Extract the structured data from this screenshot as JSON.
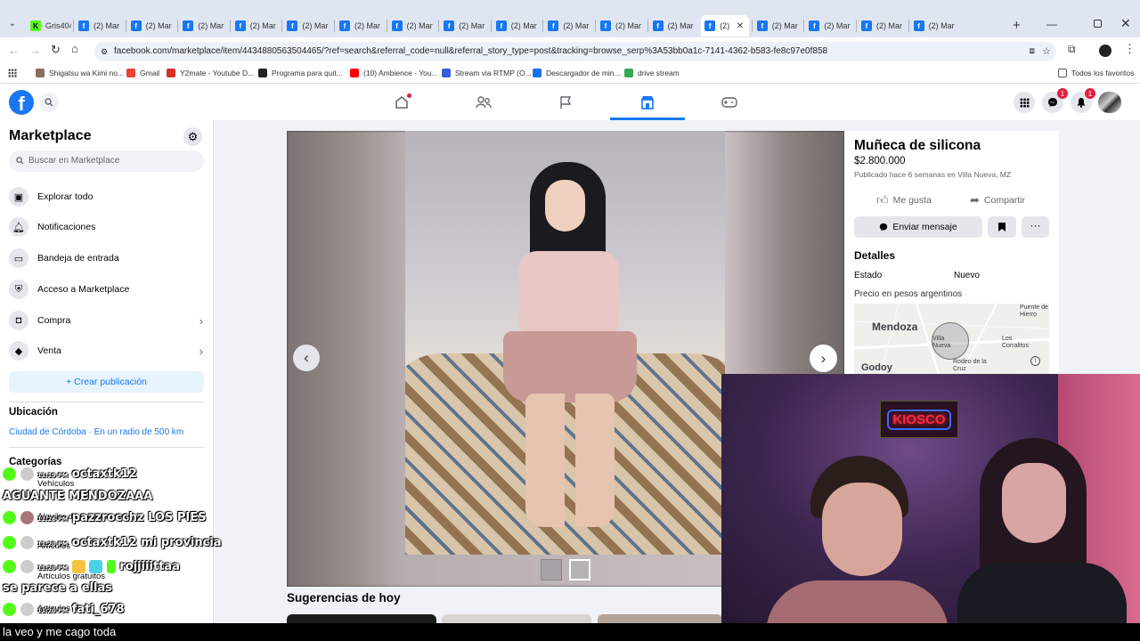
{
  "browser": {
    "tabs": [
      {
        "label": "Gris404",
        "icon": "kick-icon"
      },
      {
        "label": "(2) Mar"
      },
      {
        "label": "(2) Mar"
      },
      {
        "label": "(2) Mar"
      },
      {
        "label": "(2) Mar"
      },
      {
        "label": "(2) Mar"
      },
      {
        "label": "(2) Mar"
      },
      {
        "label": "(2) Mar"
      },
      {
        "label": "(2) Mar"
      },
      {
        "label": "(2) Mar"
      },
      {
        "label": "(2) Mar"
      },
      {
        "label": "(2) Mar"
      },
      {
        "label": "(2) Mar"
      },
      {
        "label": "(2)",
        "active": true
      },
      {
        "label": "(2) Mar"
      },
      {
        "label": "(2) Mar"
      },
      {
        "label": "(2) Mar"
      },
      {
        "label": "(2) Mar"
      }
    ],
    "url": "facebook.com/marketplace/item/4434880563504465/?ref=search&referral_code=null&referral_story_type=post&tracking=browse_serp%3A53bb0a1c-7141-4362-b583-fe8c97e0f858",
    "bookmarks": [
      "Shigatsu wa Kimi no...",
      "Gmail",
      "Y2mate - Youtube D...",
      "Programa para quit...",
      "(10) Ambience - You...",
      "Stream via RTMP (O...",
      "Descargador de min...",
      "drive stream"
    ],
    "all_bookmarks": "Todos los favoritos"
  },
  "header": {
    "messenger_badge": "1",
    "notifications_badge": "1"
  },
  "sidebar": {
    "title": "Marketplace",
    "search_placeholder": "Buscar en Marketplace",
    "items": [
      {
        "label": "Explorar todo",
        "icon": "shop-icon"
      },
      {
        "label": "Notificaciones",
        "icon": "bell-icon"
      },
      {
        "label": "Bandeja de entrada",
        "icon": "inbox-icon"
      },
      {
        "label": "Acceso a Marketplace",
        "icon": "shield-icon"
      },
      {
        "label": "Compra",
        "icon": "bag-icon"
      },
      {
        "label": "Venta",
        "icon": "tag-icon"
      }
    ],
    "create_button": "+ Crear publicación",
    "location_heading": "Ubicación",
    "location_value": "Ciudad de Córdoba · En un radio de 500 km",
    "categories_heading": "Categorías",
    "category_items": [
      "Vehículos",
      "Alquiler de propiedades",
      "Artículos",
      "Artículos gratuitos",
      "Artículos"
    ]
  },
  "listing": {
    "title": "Muñeca de silicona",
    "price": "$2.800.000",
    "posted": "Publicado hace 6 semanas en Villa Nueva, MZ",
    "like_label": "Me gusta",
    "share_label": "Compartir",
    "message_label": "Enviar mensaje",
    "details_heading": "Detalles",
    "state_label": "Estado",
    "state_value": "Nuevo",
    "currency_note": "Precio en pesos argentinos",
    "map_labels": {
      "mendoza": "Mendoza",
      "villa_nueva": "Villa Nueva",
      "puente": "Puente de Hierro",
      "corralitos": "Los Corralitos",
      "rodeo": "Rodeo de la Cruz",
      "godoy": "Godoy"
    },
    "suggestions_heading": "Sugerencias de hoy"
  },
  "overlay": {
    "chat": [
      {
        "time": "11:19 PM",
        "user": "octaxtk12",
        "text": ""
      },
      {
        "time": "",
        "user": "",
        "text": "AGUANTE MENDOZAAA"
      },
      {
        "time": "11:26 PM",
        "user": "pazzrocchz",
        "text": "LOS PIES"
      },
      {
        "time": "11:20 PM",
        "user": "octaxtk12",
        "text": "mi provincia"
      },
      {
        "time": "11:20 PM",
        "user": "rojjiiittaa",
        "text": ""
      },
      {
        "time": "",
        "user": "",
        "text": "se parece a ellas"
      },
      {
        "time": "11:20 PM",
        "user": "fati_678",
        "text": ""
      }
    ],
    "neon_sign": "KIOSCO",
    "caption": "la veo y me cago toda"
  },
  "colors": {
    "fb_blue": "#1877f2",
    "kick_green": "#53fc18",
    "neon_red": "#ff2a3c"
  }
}
